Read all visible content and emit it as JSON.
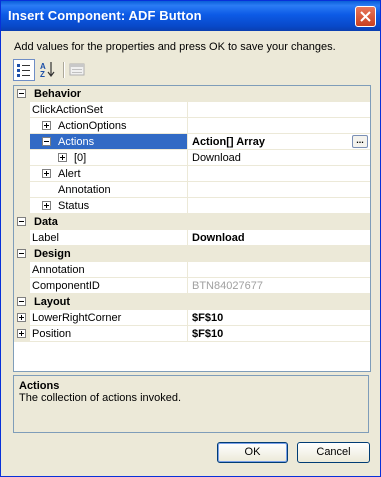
{
  "window": {
    "title": "Insert Component: ADF Button"
  },
  "instructions": "Add values for the properties and press OK to save your changes.",
  "toolbar": {
    "buttons": [
      {
        "icon": "categorized-icon",
        "pressed": true
      },
      {
        "icon": "alphabetical-sort-icon",
        "pressed": false
      },
      {
        "icon": "property-pages-icon",
        "pressed": false,
        "disabled": true
      }
    ]
  },
  "grid": {
    "rows": [
      {
        "type": "category",
        "name": "Behavior",
        "expander": "minus"
      },
      {
        "type": "prop",
        "name": "ClickActionSet",
        "value": "",
        "level": 0
      },
      {
        "type": "prop",
        "name": "ActionOptions",
        "value": "",
        "level": 1,
        "expander": "plus"
      },
      {
        "type": "prop",
        "name": "Actions",
        "value": "Action[] Array",
        "level": 1,
        "expander": "minus",
        "selected": true,
        "bold": true,
        "ellipsis": "..."
      },
      {
        "type": "prop",
        "name": "[0]",
        "value": "Download",
        "level": 2,
        "expander": "plus"
      },
      {
        "type": "prop",
        "name": "Alert",
        "value": "",
        "level": 1,
        "expander": "plus"
      },
      {
        "type": "prop",
        "name": "Annotation",
        "value": "",
        "level": 1
      },
      {
        "type": "prop",
        "name": "Status",
        "value": "",
        "level": 1,
        "expander": "plus"
      },
      {
        "type": "category",
        "name": "Data",
        "expander": "minus"
      },
      {
        "type": "prop",
        "name": "Label",
        "value": "Download",
        "level": 0,
        "bold": true
      },
      {
        "type": "category",
        "name": "Design",
        "expander": "minus"
      },
      {
        "type": "prop",
        "name": "Annotation",
        "value": "",
        "level": 0
      },
      {
        "type": "prop",
        "name": "ComponentID",
        "value": "BTN84027677",
        "level": 0,
        "disabled": true
      },
      {
        "type": "category",
        "name": "Layout",
        "expander": "minus"
      },
      {
        "type": "prop",
        "name": "LowerRightCorner",
        "value": "$F$10",
        "level": 0,
        "expander": "plus",
        "bold": true
      },
      {
        "type": "prop",
        "name": "Position",
        "value": "$F$10",
        "level": 0,
        "expander": "plus",
        "bold": true
      }
    ]
  },
  "description": {
    "title": "Actions",
    "text": "The collection of actions invoked."
  },
  "buttons": {
    "ok": "OK",
    "cancel": "Cancel"
  },
  "colors": {
    "title_bar": "#0a5fd8",
    "selection": "#316ac5",
    "dialog_bg": "#ece9d8"
  }
}
